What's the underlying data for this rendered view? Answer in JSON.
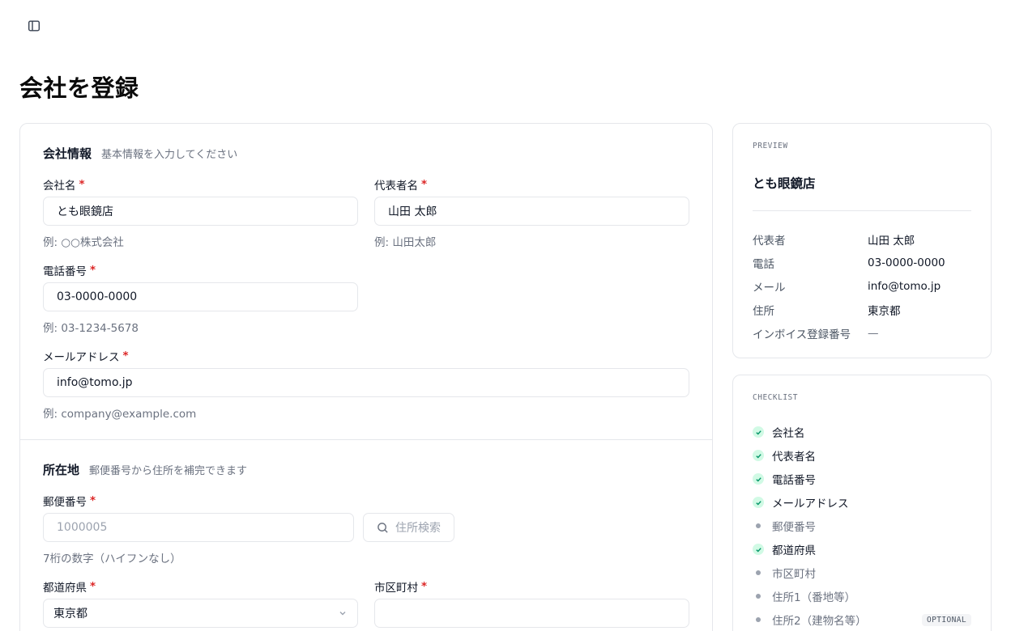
{
  "page": {
    "title": "会社を登録"
  },
  "sections": {
    "company": {
      "title": "会社情報",
      "desc": "基本情報を入力してください"
    },
    "address": {
      "title": "所在地",
      "desc": "郵便番号から住所を補完できます"
    }
  },
  "fields": {
    "company_name": {
      "label": "会社名",
      "value": "とも眼鏡店",
      "help": "例: ○○株式会社"
    },
    "representative": {
      "label": "代表者名",
      "value": "山田 太郎",
      "help": "例: 山田太郎"
    },
    "phone": {
      "label": "電話番号",
      "value": "03-0000-0000",
      "help": "例: 03-1234-5678"
    },
    "email": {
      "label": "メールアドレス",
      "value": "info@tomo.jp",
      "help": "例: company@example.com"
    },
    "postal": {
      "label": "郵便番号",
      "placeholder": "1000005",
      "help": "7桁の数字（ハイフンなし）"
    },
    "search_button": {
      "label": "住所検索"
    },
    "prefecture": {
      "label": "都道府県",
      "value": "東京都"
    },
    "city": {
      "label": "市区町村",
      "value": ""
    }
  },
  "required_mark": "*",
  "preview": {
    "label": "PREVIEW",
    "name": "とも眼鏡店",
    "rows": [
      {
        "key": "代表者",
        "value": "山田 太郎"
      },
      {
        "key": "電話",
        "value": "03-0000-0000"
      },
      {
        "key": "メール",
        "value": "info@tomo.jp"
      },
      {
        "key": "住所",
        "value": "東京都"
      },
      {
        "key": "インボイス登録番号",
        "value": "—"
      }
    ]
  },
  "checklist": {
    "label": "CHECKLIST",
    "optional_label": "OPTIONAL",
    "items": [
      {
        "label": "会社名",
        "done": true
      },
      {
        "label": "代表者名",
        "done": true
      },
      {
        "label": "電話番号",
        "done": true
      },
      {
        "label": "メールアドレス",
        "done": true
      },
      {
        "label": "郵便番号",
        "done": false
      },
      {
        "label": "都道府県",
        "done": true
      },
      {
        "label": "市区町村",
        "done": false
      },
      {
        "label": "住所1（番地等）",
        "done": false
      },
      {
        "label": "住所2（建物名等）",
        "done": false,
        "optional": true
      }
    ]
  },
  "icons": {
    "sidebar_toggle": "sidebar-toggle-icon",
    "search": "search-icon",
    "chevron": "chevron-down-icon",
    "check": "check-icon",
    "dot": "dot-icon"
  },
  "colors": {
    "required": "#dc2626",
    "check_bg": "#d1fae5",
    "check_fg": "#059669"
  }
}
